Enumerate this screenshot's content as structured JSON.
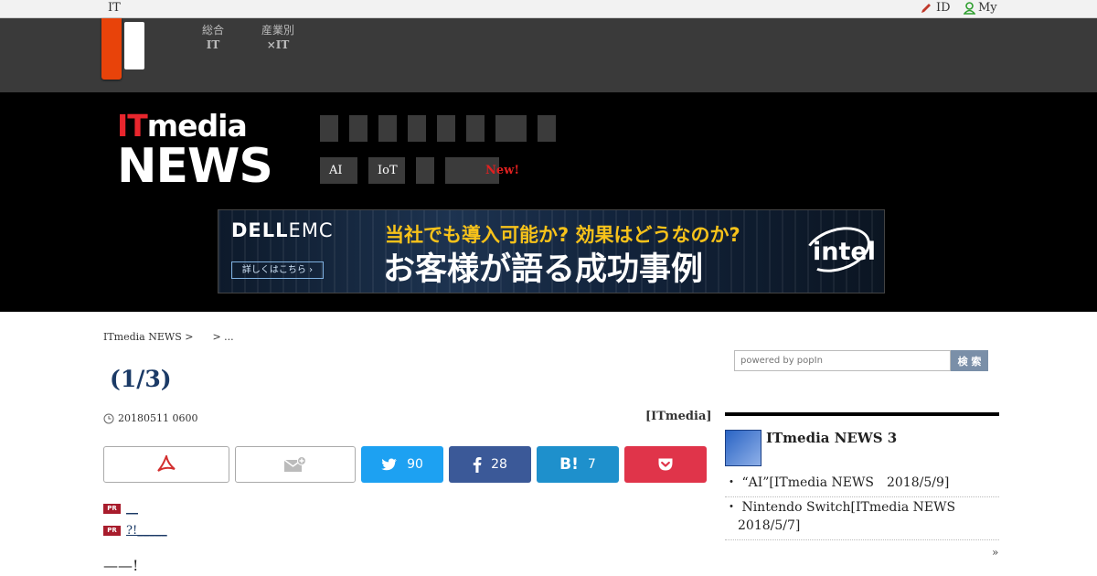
{
  "topbar": {
    "it_label": "IT",
    "id_label": "ID",
    "my_label": "My"
  },
  "grayhead": {
    "nav": [
      {
        "line1": "総合",
        "line2": "IT"
      },
      {
        "line1": "産業別",
        "line2": "×IT"
      }
    ]
  },
  "masthead": {
    "brand_line1_red": "IT",
    "brand_line1_rest": "media",
    "brand_line2": "NEWS",
    "tags": [
      "AI",
      "IoT"
    ],
    "new_label": "New!"
  },
  "ad": {
    "brand_bold": "DELL",
    "brand_light": "EMC",
    "more_label": "詳しくはこちら",
    "headline1": "当社でも導入可能か? 効果はどうなのか?",
    "headline2": "お客様が語る成功事例",
    "intel": "intel"
  },
  "breadcrumb": {
    "home": "ITmedia NEWS >",
    "sep": "> ..."
  },
  "article": {
    "title": "(1/3)",
    "date": "20180511 0600",
    "byline": "[ITmedia]",
    "lead": "——!"
  },
  "share": {
    "twitter_count": "90",
    "facebook_count": "28",
    "hatena_count": "7",
    "hatena_label": "B!"
  },
  "pr_links": [
    {
      "badge": "PR",
      "text": "__"
    },
    {
      "badge": "PR",
      "text": "?!_____"
    }
  ],
  "sidebar": {
    "search_placeholder": "powered by popIn",
    "search_button": "検 索",
    "section_title": "ITmedia NEWS 3",
    "items": [
      "・ “AI”[ITmedia NEWS　2018/5/9]",
      "・ Nintendo Switch[ITmedia NEWS　2018/5/7]"
    ],
    "more_label": "»"
  },
  "colors": {
    "accent_red": "#e8262d",
    "link": "#1b3a66",
    "twitter": "#1da1f2",
    "facebook": "#3b5998",
    "hatena": "#1e90cc",
    "pocket": "#e0344a"
  }
}
